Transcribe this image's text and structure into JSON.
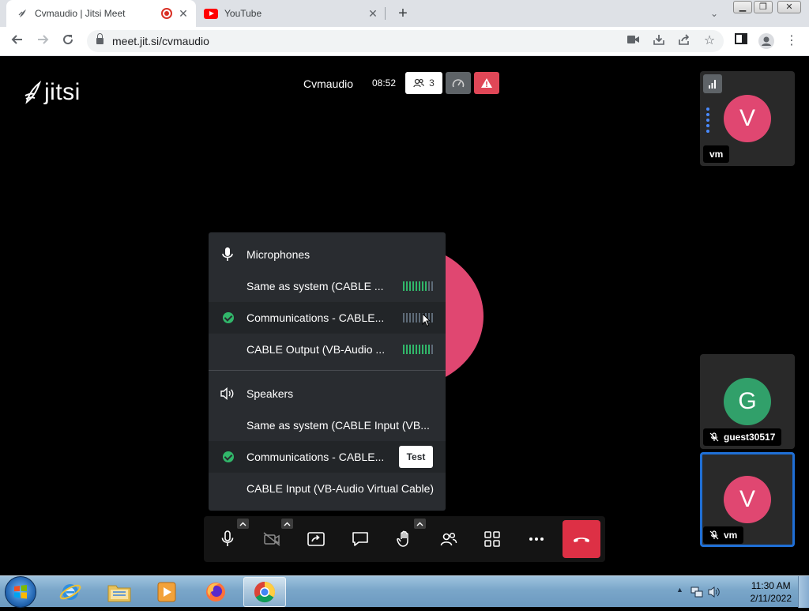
{
  "browser": {
    "tabs": [
      {
        "title": "Cvmaudio | Jitsi Meet",
        "active": true,
        "recording": true
      },
      {
        "title": "YouTube",
        "active": false
      }
    ],
    "url": "meet.jit.si/cvmaudio",
    "new_tab_symbol": "+",
    "close_symbol": "✕"
  },
  "meeting": {
    "logo_text": "jitsi",
    "name": "Cvmaudio",
    "timer": "08:52",
    "participant_count": "3"
  },
  "filmstrip": [
    {
      "initial": "V",
      "name": "vm",
      "color": "#e04771"
    },
    {
      "initial": "G",
      "name": "guest30517",
      "color": "#31a06a"
    },
    {
      "initial": "V",
      "name": "vm",
      "color": "#e04771"
    }
  ],
  "audio_menu": {
    "microphones_title": "Microphones",
    "microphones": [
      {
        "label": "Same as system (CABLE ...",
        "selected": false
      },
      {
        "label": "Communications - CABLE...",
        "selected": true
      },
      {
        "label": "CABLE Output (VB-Audio ...",
        "selected": false
      }
    ],
    "speakers_title": "Speakers",
    "speakers": [
      {
        "label": "Same as system (CABLE Input (VB...",
        "selected": false
      },
      {
        "label": "Communications - CABLE...",
        "selected": true
      },
      {
        "label": "CABLE Input (VB-Audio Virtual Cable)",
        "selected": false
      }
    ],
    "test_label": "Test"
  },
  "colors": {
    "accent_green": "#31b76a",
    "hangup_red": "#dd3045",
    "warning_red": "#e04757",
    "active_border": "#1f6fd6"
  },
  "taskbar": {
    "time": "11:30 AM",
    "date": "2/11/2022"
  }
}
